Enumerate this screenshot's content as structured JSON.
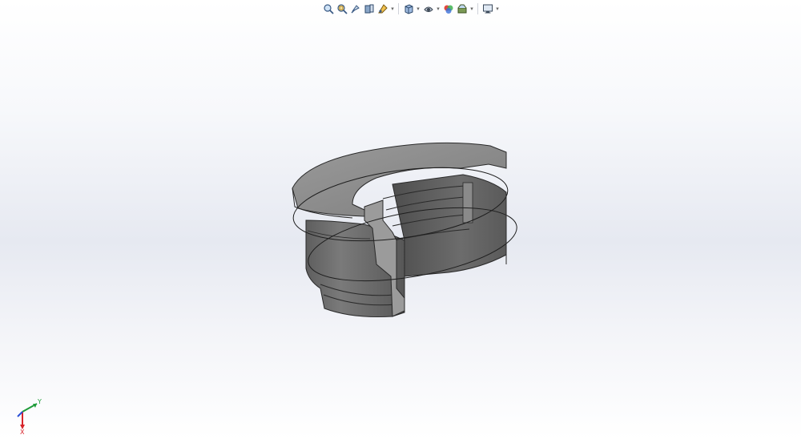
{
  "window": {
    "title": ""
  },
  "view_toolbar": {
    "items": [
      {
        "name": "zoom-to-fit",
        "icon": "zoom-fit-icon"
      },
      {
        "name": "zoom-to-area",
        "icon": "zoom-area-icon"
      },
      {
        "name": "previous-view",
        "icon": "previous-view-icon"
      },
      {
        "name": "section-view",
        "icon": "section-view-icon"
      },
      {
        "name": "dynamic-annotation-views",
        "icon": "annotation-view-icon"
      },
      {
        "name": "view-orientation",
        "icon": "view-orientation-icon",
        "has_dropdown": true
      },
      {
        "name": "display-style",
        "icon": "display-style-icon",
        "has_dropdown": true
      },
      {
        "name": "hide-show-items",
        "icon": "hide-show-icon",
        "has_dropdown": true
      },
      {
        "name": "edit-appearance",
        "icon": "edit-appearance-icon"
      },
      {
        "name": "apply-scene",
        "icon": "apply-scene-icon",
        "has_dropdown": true
      },
      {
        "name": "view-settings",
        "icon": "monitor-icon",
        "has_dropdown": true
      }
    ],
    "dropdown_glyph": "▾"
  },
  "triad": {
    "x_label": "X",
    "y_label": "Y",
    "colors": {
      "x": "#d8232a",
      "y": "#1f9c3a",
      "z": "#2a4fd6"
    }
  },
  "model": {
    "body_color": "#6f6f6f",
    "edge_color": "#2a2a2a",
    "highlight_color": "#8e8e8e"
  }
}
